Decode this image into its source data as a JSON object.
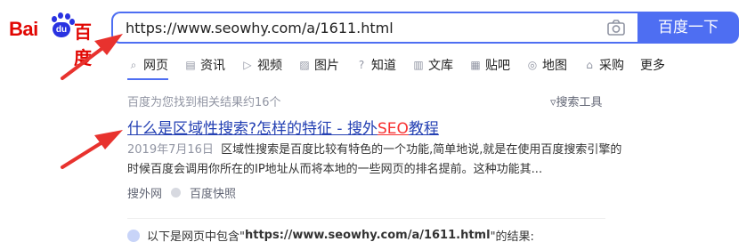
{
  "logo": {
    "bai": "Bai",
    "du": "du",
    "cn": "百度"
  },
  "search": {
    "query": "https://www.seowhy.com/a/1611.html",
    "button_label": "百度一下"
  },
  "tabs": [
    {
      "label": "网页",
      "icon": "search-icon",
      "glyph": "⌕"
    },
    {
      "label": "资讯",
      "icon": "news-icon",
      "glyph": "▤"
    },
    {
      "label": "视频",
      "icon": "video-icon",
      "glyph": "▷"
    },
    {
      "label": "图片",
      "icon": "image-icon",
      "glyph": "▨"
    },
    {
      "label": "知道",
      "icon": "question-icon",
      "glyph": "?"
    },
    {
      "label": "文库",
      "icon": "document-icon",
      "glyph": "▥"
    },
    {
      "label": "贴吧",
      "icon": "forum-icon",
      "glyph": "▦"
    },
    {
      "label": "地图",
      "icon": "map-icon",
      "glyph": "◎"
    },
    {
      "label": "采购",
      "icon": "cart-icon",
      "glyph": "⌂"
    },
    {
      "label": "更多",
      "icon": "",
      "glyph": ""
    }
  ],
  "results_meta": {
    "count_text": "百度为您找到相关结果约16个",
    "tools_label": "搜索工具",
    "tools_icon": "filter-icon"
  },
  "result": {
    "title_before": "什么是区域性搜索?怎样的特征 - 搜外",
    "title_highlight": "SEO",
    "title_after": "教程",
    "date": "2019年7月16日",
    "abstract": "区域性搜索是百度比较有特色的一个功能,简单地说,就是在使用百度搜索引擎的时候百度会调用你所在的IP地址从而将本地的一些网页的排名提前。这种功能其...",
    "source": "搜外网",
    "snapshot": "百度快照"
  },
  "notice": {
    "prefix": "以下是网页中包含\"",
    "url": "https://www.seowhy.com/a/1611.html",
    "suffix": "\"的结果:"
  },
  "colors": {
    "brand_blue": "#4e6ef2",
    "logo_red": "#e10602",
    "link_blue": "#2440b3",
    "highlight_red": "#f73131",
    "arrow_red": "#e8322e"
  }
}
